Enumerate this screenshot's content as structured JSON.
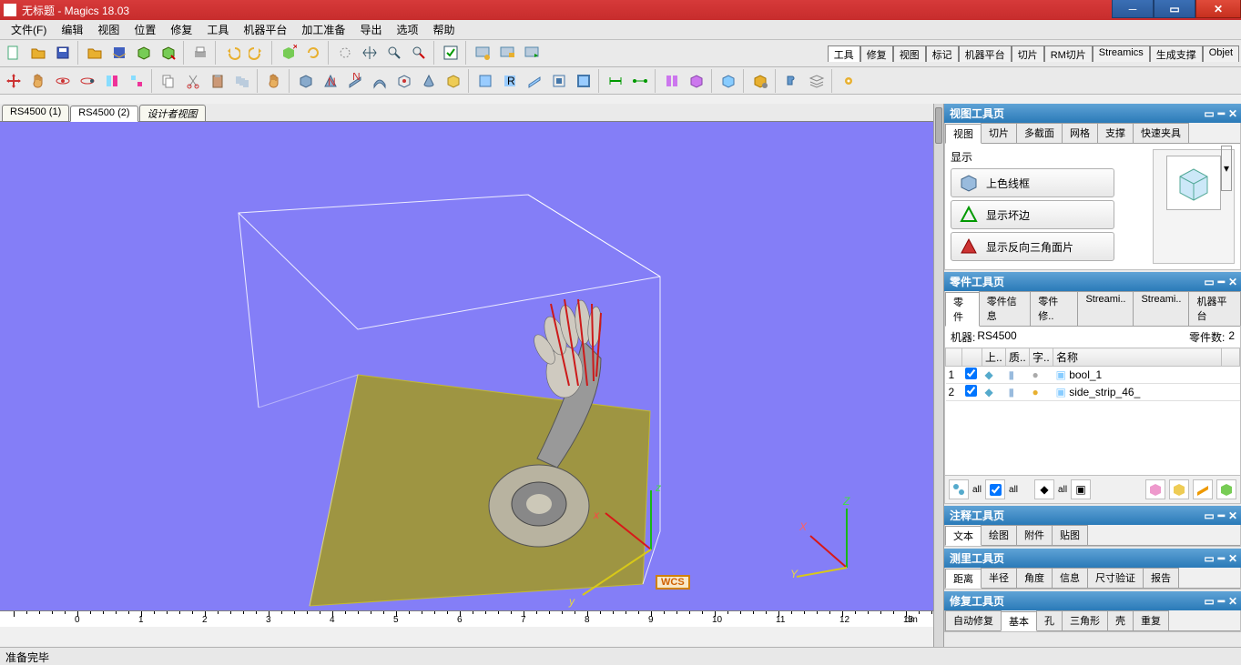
{
  "title": "无标题 - Magics 18.03",
  "menu": [
    "文件(F)",
    "编辑",
    "视图",
    "位置",
    "修复",
    "工具",
    "机器平台",
    "加工准备",
    "导出",
    "选项",
    "帮助"
  ],
  "context_tabs": [
    "工具",
    "修复",
    "视图",
    "标记",
    "机器平台",
    "切片",
    "RM切片",
    "Streamics",
    "生成支撑",
    "Objet"
  ],
  "scene_tabs": [
    "RS4500 (1)",
    "RS4500 (2)",
    "设计者视图"
  ],
  "ruler": {
    "labels": [
      "",
      "0",
      "1",
      "2",
      "3",
      "4",
      "5",
      "6",
      "7",
      "8",
      "9",
      "10",
      "11",
      "12",
      "13"
    ],
    "unit": "dm"
  },
  "wcs": "WCS",
  "axes": {
    "x": "x",
    "y": "y",
    "z": "z",
    "X": "X",
    "Y": "Y",
    "Z": "Z"
  },
  "panel_view": {
    "title": "视图工具页",
    "tabs": [
      "视图",
      "切片",
      "多截面",
      "网格",
      "支撑",
      "快速夹具"
    ],
    "section_label": "显示",
    "buttons": [
      "上色线框",
      "显示坏边",
      "显示反向三角面片"
    ]
  },
  "panel_parts": {
    "title": "零件工具页",
    "tabs": [
      "零件",
      "零件信息",
      "零件修..",
      "Streami..",
      "Streami..",
      "机器平台"
    ],
    "machine_label": "机器:",
    "machine_value": "RS4500",
    "count_label": "零件数:",
    "count_value": "2",
    "columns": [
      "",
      "",
      "上..",
      "质..",
      "字..",
      "名称",
      ""
    ],
    "rows": [
      {
        "idx": "1",
        "name": "bool_1"
      },
      {
        "idx": "2",
        "name": "side_strip_46_"
      }
    ],
    "all_label": "all"
  },
  "panel_annot": {
    "title": "注释工具页",
    "tabs": [
      "文本",
      "绘图",
      "附件",
      "贴图"
    ]
  },
  "panel_measure": {
    "title": "测里工具页",
    "tabs": [
      "距离",
      "半径",
      "角度",
      "信息",
      "尺寸验证",
      "报告"
    ]
  },
  "panel_fix": {
    "title": "修复工具页",
    "tabs": [
      "自动修复",
      "基本",
      "孔",
      "三角形",
      "壳",
      "重复",
      "..."
    ]
  },
  "status": "准备完毕"
}
